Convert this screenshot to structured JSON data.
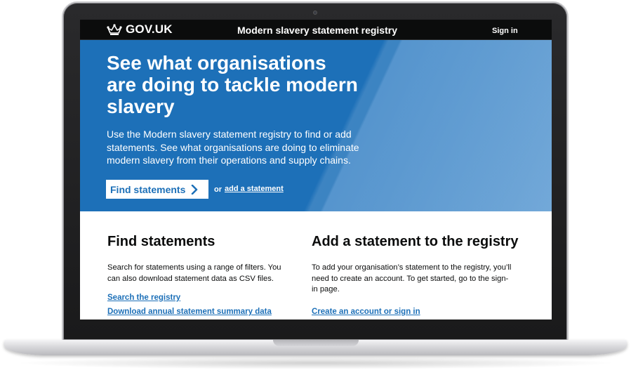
{
  "header": {
    "logo_text": "GOV.UK",
    "service_name": "Modern slavery statement registry",
    "sign_in": "Sign in"
  },
  "hero": {
    "title": "See what organisations are doing to tackle modern slavery",
    "body": "Use the Modern slavery statement registry to find or add statements. See what organisations are doing to eliminate modern slavery from their operations and supply chains.",
    "button_label": "Find statements",
    "or_text": "or",
    "add_link": "add a statement"
  },
  "find": {
    "heading": "Find statements",
    "body": "Search for statements using a range of filters. You can also download statement data as CSV files.",
    "links": [
      "Search the registry",
      "Download annual statement summary data"
    ]
  },
  "add": {
    "heading": "Add a statement to the registry",
    "body": "To add your organisation’s statement to the registry, you’ll need to create an account. To get started, go to the sign-in page.",
    "link": "Create an account or sign in"
  },
  "colors": {
    "brand_blue": "#1d70b8",
    "header_black": "#0b0c0c",
    "link_blue": "#1d70b8"
  },
  "icons": [
    "crown-icon",
    "chevron-right-icon"
  ]
}
